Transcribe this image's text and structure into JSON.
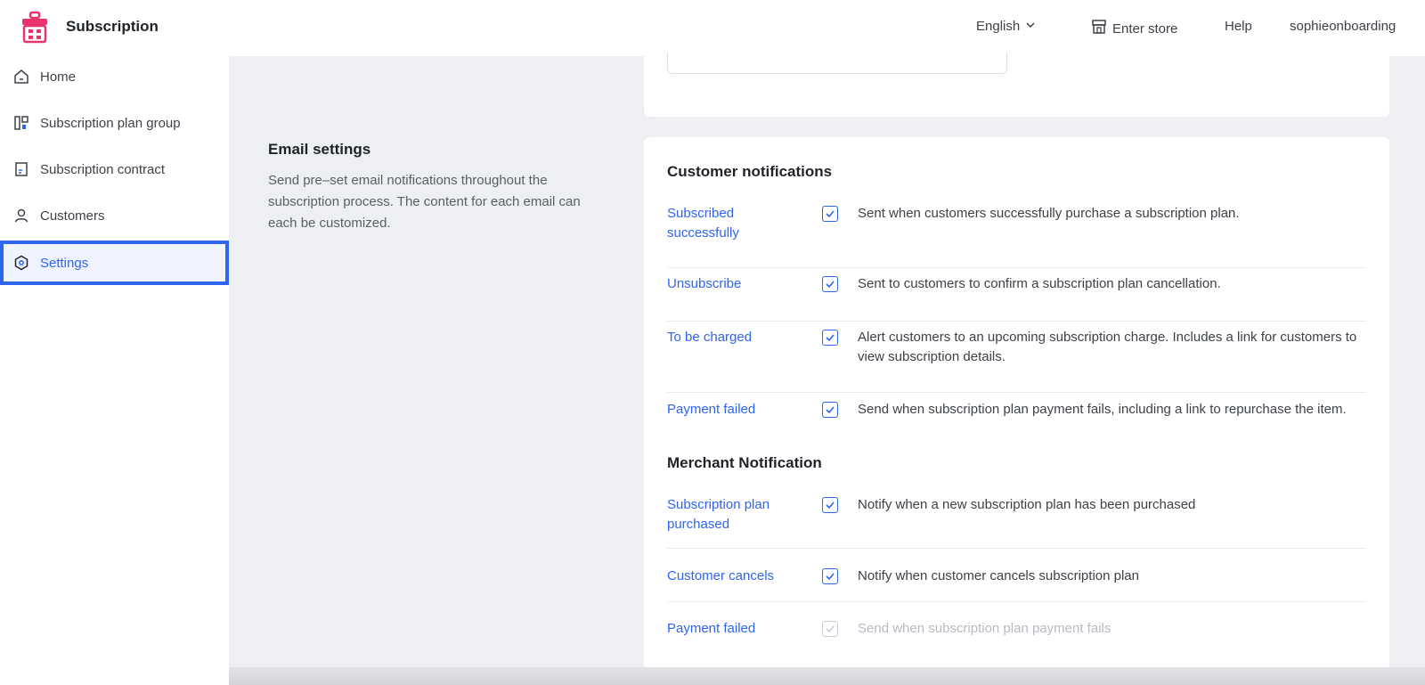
{
  "app": {
    "title": "Subscription"
  },
  "header": {
    "language": "English",
    "enter_store": "Enter store",
    "help": "Help",
    "user": "sophieonboarding"
  },
  "sidebar": {
    "items": [
      {
        "label": "Home",
        "icon": "home-icon"
      },
      {
        "label": "Subscription plan group",
        "icon": "plan-group-icon"
      },
      {
        "label": "Subscription contract",
        "icon": "contract-icon"
      },
      {
        "label": "Customers",
        "icon": "user-icon"
      },
      {
        "label": "Settings",
        "icon": "settings-icon",
        "active": true
      }
    ]
  },
  "email_settings": {
    "title": "Email settings",
    "description": "Send pre–set email notifications throughout the subscription process. The content for each email can each be customized."
  },
  "customer_notifications": {
    "title": "Customer notifications",
    "rows": [
      {
        "label": "Subscribed successfully",
        "checked": true,
        "description": "Sent when customers successfully purchase a subscription plan."
      },
      {
        "label": "Unsubscribe",
        "checked": true,
        "description": "Sent to customers to confirm a subscription plan cancellation."
      },
      {
        "label": "To be charged",
        "checked": true,
        "description": "Alert customers to an upcoming subscription charge. Includes a link for customers to view subscription details."
      },
      {
        "label": "Payment failed",
        "checked": true,
        "description": "Send when subscription plan payment fails, including a link to repurchase the item."
      }
    ]
  },
  "merchant_notifications": {
    "title": "Merchant Notification",
    "rows": [
      {
        "label": "Subscription plan purchased",
        "checked": true,
        "description": "Notify when a new subscription plan has been purchased"
      },
      {
        "label": "Customer cancels",
        "checked": true,
        "description": "Notify when customer cancels subscription plan"
      },
      {
        "label": "Payment failed",
        "checked": true,
        "disabled": true,
        "description": "Send when subscription plan payment fails"
      }
    ]
  },
  "colors": {
    "accent": "#2f64ef",
    "brand": "#e8336d",
    "background": "#eeeff3"
  }
}
